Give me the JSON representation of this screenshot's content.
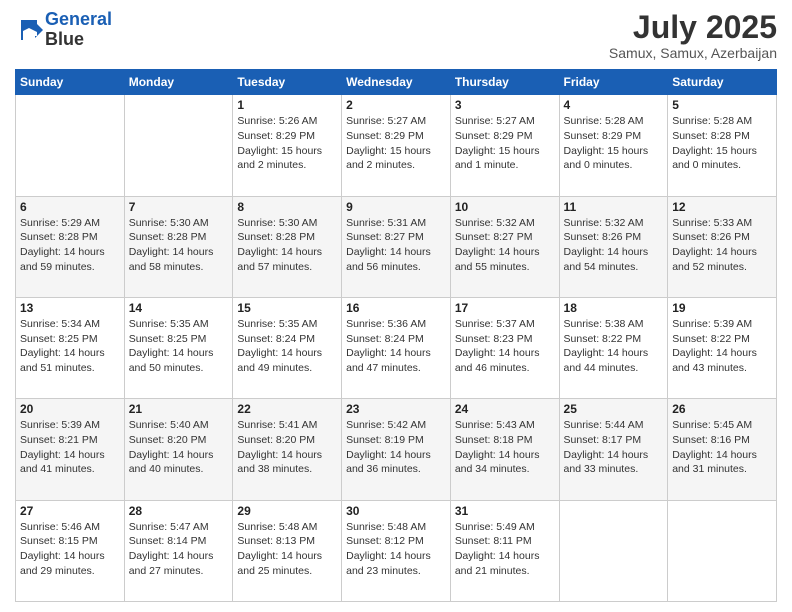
{
  "header": {
    "logo_line1": "General",
    "logo_line2": "Blue",
    "month": "July 2025",
    "location": "Samux, Samux, Azerbaijan"
  },
  "weekdays": [
    "Sunday",
    "Monday",
    "Tuesday",
    "Wednesday",
    "Thursday",
    "Friday",
    "Saturday"
  ],
  "weeks": [
    [
      {
        "day": "",
        "info": ""
      },
      {
        "day": "",
        "info": ""
      },
      {
        "day": "1",
        "info": "Sunrise: 5:26 AM\nSunset: 8:29 PM\nDaylight: 15 hours\nand 2 minutes."
      },
      {
        "day": "2",
        "info": "Sunrise: 5:27 AM\nSunset: 8:29 PM\nDaylight: 15 hours\nand 2 minutes."
      },
      {
        "day": "3",
        "info": "Sunrise: 5:27 AM\nSunset: 8:29 PM\nDaylight: 15 hours\nand 1 minute."
      },
      {
        "day": "4",
        "info": "Sunrise: 5:28 AM\nSunset: 8:29 PM\nDaylight: 15 hours\nand 0 minutes."
      },
      {
        "day": "5",
        "info": "Sunrise: 5:28 AM\nSunset: 8:28 PM\nDaylight: 15 hours\nand 0 minutes."
      }
    ],
    [
      {
        "day": "6",
        "info": "Sunrise: 5:29 AM\nSunset: 8:28 PM\nDaylight: 14 hours\nand 59 minutes."
      },
      {
        "day": "7",
        "info": "Sunrise: 5:30 AM\nSunset: 8:28 PM\nDaylight: 14 hours\nand 58 minutes."
      },
      {
        "day": "8",
        "info": "Sunrise: 5:30 AM\nSunset: 8:28 PM\nDaylight: 14 hours\nand 57 minutes."
      },
      {
        "day": "9",
        "info": "Sunrise: 5:31 AM\nSunset: 8:27 PM\nDaylight: 14 hours\nand 56 minutes."
      },
      {
        "day": "10",
        "info": "Sunrise: 5:32 AM\nSunset: 8:27 PM\nDaylight: 14 hours\nand 55 minutes."
      },
      {
        "day": "11",
        "info": "Sunrise: 5:32 AM\nSunset: 8:26 PM\nDaylight: 14 hours\nand 54 minutes."
      },
      {
        "day": "12",
        "info": "Sunrise: 5:33 AM\nSunset: 8:26 PM\nDaylight: 14 hours\nand 52 minutes."
      }
    ],
    [
      {
        "day": "13",
        "info": "Sunrise: 5:34 AM\nSunset: 8:25 PM\nDaylight: 14 hours\nand 51 minutes."
      },
      {
        "day": "14",
        "info": "Sunrise: 5:35 AM\nSunset: 8:25 PM\nDaylight: 14 hours\nand 50 minutes."
      },
      {
        "day": "15",
        "info": "Sunrise: 5:35 AM\nSunset: 8:24 PM\nDaylight: 14 hours\nand 49 minutes."
      },
      {
        "day": "16",
        "info": "Sunrise: 5:36 AM\nSunset: 8:24 PM\nDaylight: 14 hours\nand 47 minutes."
      },
      {
        "day": "17",
        "info": "Sunrise: 5:37 AM\nSunset: 8:23 PM\nDaylight: 14 hours\nand 46 minutes."
      },
      {
        "day": "18",
        "info": "Sunrise: 5:38 AM\nSunset: 8:22 PM\nDaylight: 14 hours\nand 44 minutes."
      },
      {
        "day": "19",
        "info": "Sunrise: 5:39 AM\nSunset: 8:22 PM\nDaylight: 14 hours\nand 43 minutes."
      }
    ],
    [
      {
        "day": "20",
        "info": "Sunrise: 5:39 AM\nSunset: 8:21 PM\nDaylight: 14 hours\nand 41 minutes."
      },
      {
        "day": "21",
        "info": "Sunrise: 5:40 AM\nSunset: 8:20 PM\nDaylight: 14 hours\nand 40 minutes."
      },
      {
        "day": "22",
        "info": "Sunrise: 5:41 AM\nSunset: 8:20 PM\nDaylight: 14 hours\nand 38 minutes."
      },
      {
        "day": "23",
        "info": "Sunrise: 5:42 AM\nSunset: 8:19 PM\nDaylight: 14 hours\nand 36 minutes."
      },
      {
        "day": "24",
        "info": "Sunrise: 5:43 AM\nSunset: 8:18 PM\nDaylight: 14 hours\nand 34 minutes."
      },
      {
        "day": "25",
        "info": "Sunrise: 5:44 AM\nSunset: 8:17 PM\nDaylight: 14 hours\nand 33 minutes."
      },
      {
        "day": "26",
        "info": "Sunrise: 5:45 AM\nSunset: 8:16 PM\nDaylight: 14 hours\nand 31 minutes."
      }
    ],
    [
      {
        "day": "27",
        "info": "Sunrise: 5:46 AM\nSunset: 8:15 PM\nDaylight: 14 hours\nand 29 minutes."
      },
      {
        "day": "28",
        "info": "Sunrise: 5:47 AM\nSunset: 8:14 PM\nDaylight: 14 hours\nand 27 minutes."
      },
      {
        "day": "29",
        "info": "Sunrise: 5:48 AM\nSunset: 8:13 PM\nDaylight: 14 hours\nand 25 minutes."
      },
      {
        "day": "30",
        "info": "Sunrise: 5:48 AM\nSunset: 8:12 PM\nDaylight: 14 hours\nand 23 minutes."
      },
      {
        "day": "31",
        "info": "Sunrise: 5:49 AM\nSunset: 8:11 PM\nDaylight: 14 hours\nand 21 minutes."
      },
      {
        "day": "",
        "info": ""
      },
      {
        "day": "",
        "info": ""
      }
    ]
  ]
}
